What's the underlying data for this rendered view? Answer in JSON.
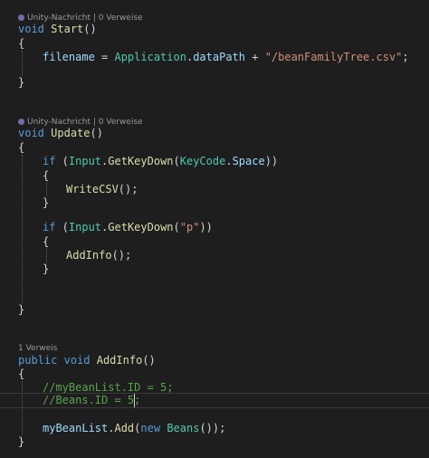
{
  "lens": {
    "start": "Unity-Nachricht | 0 Verweise",
    "update": "Unity-Nachricht | 0 Verweise",
    "addinfo": "1 Verweis"
  },
  "icons": {
    "unity_message": "unity-message-icon"
  },
  "colors": {
    "background": "#1e1e1e",
    "keyword": "#569cd6",
    "function": "#dcdcaa",
    "type": "#4ec9b0",
    "identifier": "#9cdcfe",
    "string": "#ce9178",
    "number": "#b5cea8",
    "comment": "#57a64a"
  },
  "code": {
    "start_kw": "void",
    "start_name": "Start",
    "start_paren": "()",
    "brace_open": "{",
    "brace_close": "}",
    "filename_var": "filename",
    "eq": " = ",
    "application": "Application",
    "dot": ".",
    "datapath": "dataPath",
    "plus": " + ",
    "csv_str": "\"/beanFamilyTree.csv\"",
    "semicolon": ";",
    "update_kw": "void",
    "update_name": "Update",
    "if_kw": "if",
    "paren_open": " (",
    "input": "Input",
    "getkeydown": "GetKeyDown",
    "lparen": "(",
    "keycode": "KeyCode",
    "space": "Space",
    "rparen2": "))",
    "writecsv": "WriteCSV",
    "call_end": "();",
    "p_str": "\"p\"",
    "addinfo_call": "AddInfo",
    "public_kw": "public",
    "void_kw": "void",
    "addinfo_name": "AddInfo",
    "comment1": "//myBeanList.ID = 5;",
    "comment2": "//Beans.ID = 5;",
    "mybeanlist": "myBeanList",
    "add": "Add",
    "new_kw": "new",
    "beans": "Beans",
    "add_end": "());"
  }
}
